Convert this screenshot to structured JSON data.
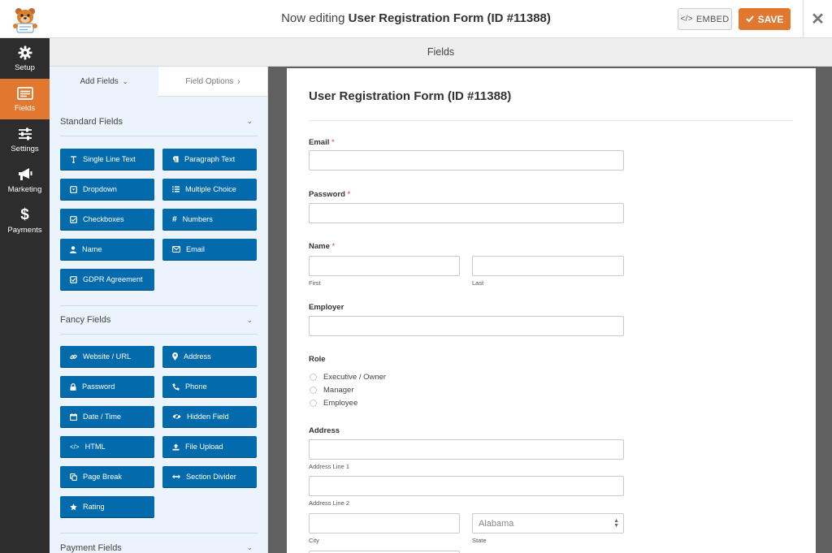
{
  "header": {
    "title_prefix": "Now editing ",
    "title_form": "User Registration Form (ID #11388)",
    "embed_label": "EMBED",
    "save_label": "SAVE"
  },
  "nav": [
    {
      "label": "Setup",
      "icon": "gear-icon"
    },
    {
      "label": "Fields",
      "icon": "fields-icon"
    },
    {
      "label": "Settings",
      "icon": "sliders-icon"
    },
    {
      "label": "Marketing",
      "icon": "megaphone-icon"
    },
    {
      "label": "Payments",
      "icon": "dollar-icon"
    }
  ],
  "section_header": "Fields",
  "panel": {
    "tab_add": "Add Fields",
    "tab_options": "Field Options",
    "standard_title": "Standard Fields",
    "standard": [
      {
        "label": "Single Line Text",
        "icon": "text-cursor-icon"
      },
      {
        "label": "Paragraph Text",
        "icon": "paragraph-icon"
      },
      {
        "label": "Dropdown",
        "icon": "dropdown-icon"
      },
      {
        "label": "Multiple Choice",
        "icon": "list-icon"
      },
      {
        "label": "Checkboxes",
        "icon": "checkbox-icon"
      },
      {
        "label": "Numbers",
        "icon": "hash-icon"
      },
      {
        "label": "Name",
        "icon": "user-icon"
      },
      {
        "label": "Email",
        "icon": "envelope-icon"
      },
      {
        "label": "GDPR Agreement",
        "icon": "checkbox-icon"
      }
    ],
    "fancy_title": "Fancy Fields",
    "fancy": [
      {
        "label": "Website / URL",
        "icon": "link-icon"
      },
      {
        "label": "Address",
        "icon": "map-pin-icon"
      },
      {
        "label": "Password",
        "icon": "lock-icon"
      },
      {
        "label": "Phone",
        "icon": "phone-icon"
      },
      {
        "label": "Date / Time",
        "icon": "calendar-icon"
      },
      {
        "label": "Hidden Field",
        "icon": "eye-slash-icon"
      },
      {
        "label": "HTML",
        "icon": "code-icon"
      },
      {
        "label": "File Upload",
        "icon": "upload-icon"
      },
      {
        "label": "Page Break",
        "icon": "copy-icon"
      },
      {
        "label": "Section Divider",
        "icon": "arrows-h-icon"
      },
      {
        "label": "Rating",
        "icon": "star-icon"
      }
    ],
    "payment_title": "Payment Fields"
  },
  "form": {
    "title": "User Registration Form (ID #11388)",
    "email_label": "Email",
    "password_label": "Password",
    "name_label": "Name",
    "first_sub": "First",
    "last_sub": "Last",
    "employer_label": "Employer",
    "role_label": "Role",
    "role_options": [
      "Executive / Owner",
      "Manager",
      "Employee"
    ],
    "address_label": "Address",
    "address_line1_sub": "Address Line 1",
    "address_line2_sub": "Address Line 2",
    "city_sub": "City",
    "state_sub": "State",
    "state_value": "Alabama",
    "required_mark": "*"
  },
  "colors": {
    "accent": "#e27730",
    "field_button": "#036aab",
    "sidebar": "#2d2d2d",
    "panel_bg": "#ebf3fc"
  }
}
